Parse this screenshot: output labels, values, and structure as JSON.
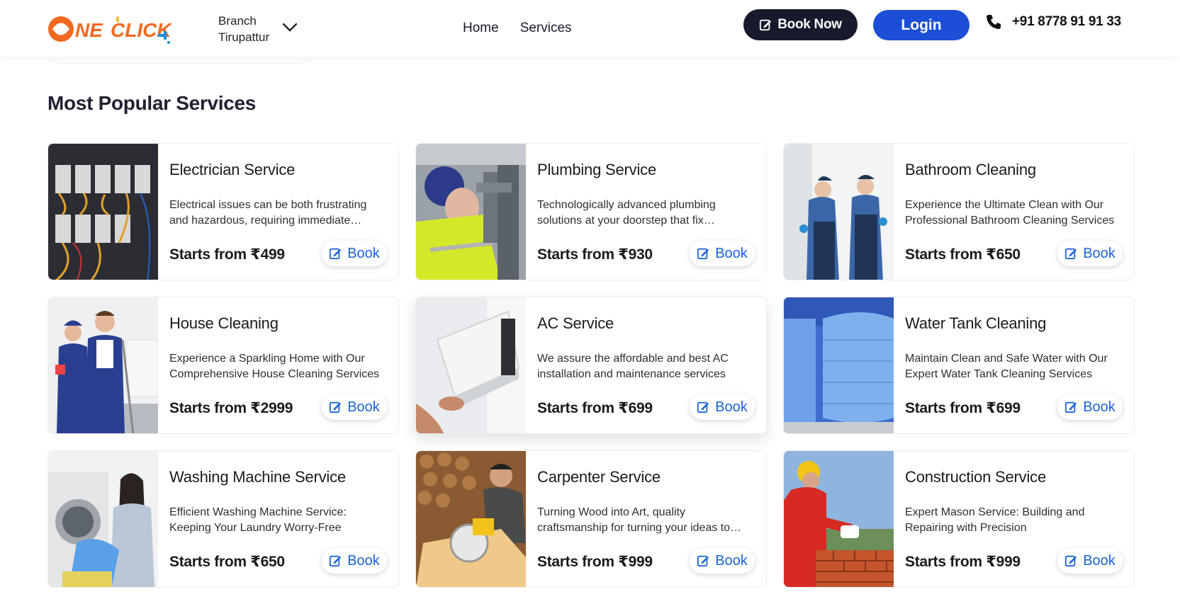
{
  "header": {
    "logo_text": "ONE CLICK",
    "branch_label": "Branch",
    "branch_value": "Tirupattur",
    "nav": [
      {
        "label": "Home"
      },
      {
        "label": "Services"
      }
    ],
    "book_now_label": "Book Now",
    "login_label": "Login",
    "phone": "+91 8778 91 91 33"
  },
  "section": {
    "title": "Most Popular Services"
  },
  "services": [
    {
      "title": "Electrician Service",
      "desc": "Electrical issues can be both frustrating and hazardous, requiring immediate attention from a professional",
      "price": "Starts from ₹499",
      "book": "Book",
      "image": "electrical-panel"
    },
    {
      "title": "Plumbing Service",
      "desc": "Technologically advanced plumbing solutions at your doorstep that fix everything",
      "price": "Starts from ₹930",
      "book": "Book",
      "image": "plumber"
    },
    {
      "title": "Bathroom Cleaning",
      "desc": "Experience the Ultimate Clean with Our Professional Bathroom Cleaning Services",
      "price": "Starts from ₹650",
      "book": "Book",
      "image": "bathroom-cleaners"
    },
    {
      "title": "House Cleaning",
      "desc": "Experience a Sparkling Home with Our Comprehensive House Cleaning Services",
      "price": "Starts from ₹2999",
      "book": "Book",
      "image": "house-cleaners"
    },
    {
      "title": "AC Service",
      "desc": "We assure the affordable and best AC installation and maintenance services",
      "price": "Starts from ₹699",
      "book": "Book",
      "image": "ac-unit"
    },
    {
      "title": "Water Tank Cleaning",
      "desc": "Maintain Clean and Safe Water with Our Expert Water Tank Cleaning Services",
      "price": "Starts from ₹699",
      "book": "Book",
      "image": "water-tanks"
    },
    {
      "title": "Washing Machine Service",
      "desc": "Efficient Washing Machine Service: Keeping Your Laundry Worry-Free",
      "price": "Starts from ₹650",
      "book": "Book",
      "image": "washing-machine"
    },
    {
      "title": "Carpenter Service",
      "desc": "Turning Wood into Art, quality craftsmanship for turning your ideas to reality",
      "price": "Starts from ₹999",
      "book": "Book",
      "image": "carpenter"
    },
    {
      "title": "Construction Service",
      "desc": "Expert Mason Service: Building and Repairing with Precision",
      "price": "Starts from ₹999",
      "book": "Book",
      "image": "mason"
    }
  ],
  "colors": {
    "primary_blue": "#1c4fd6",
    "dark": "#161a2b",
    "book_blue": "#1c63d6",
    "logo_orange": "#f26a21"
  }
}
